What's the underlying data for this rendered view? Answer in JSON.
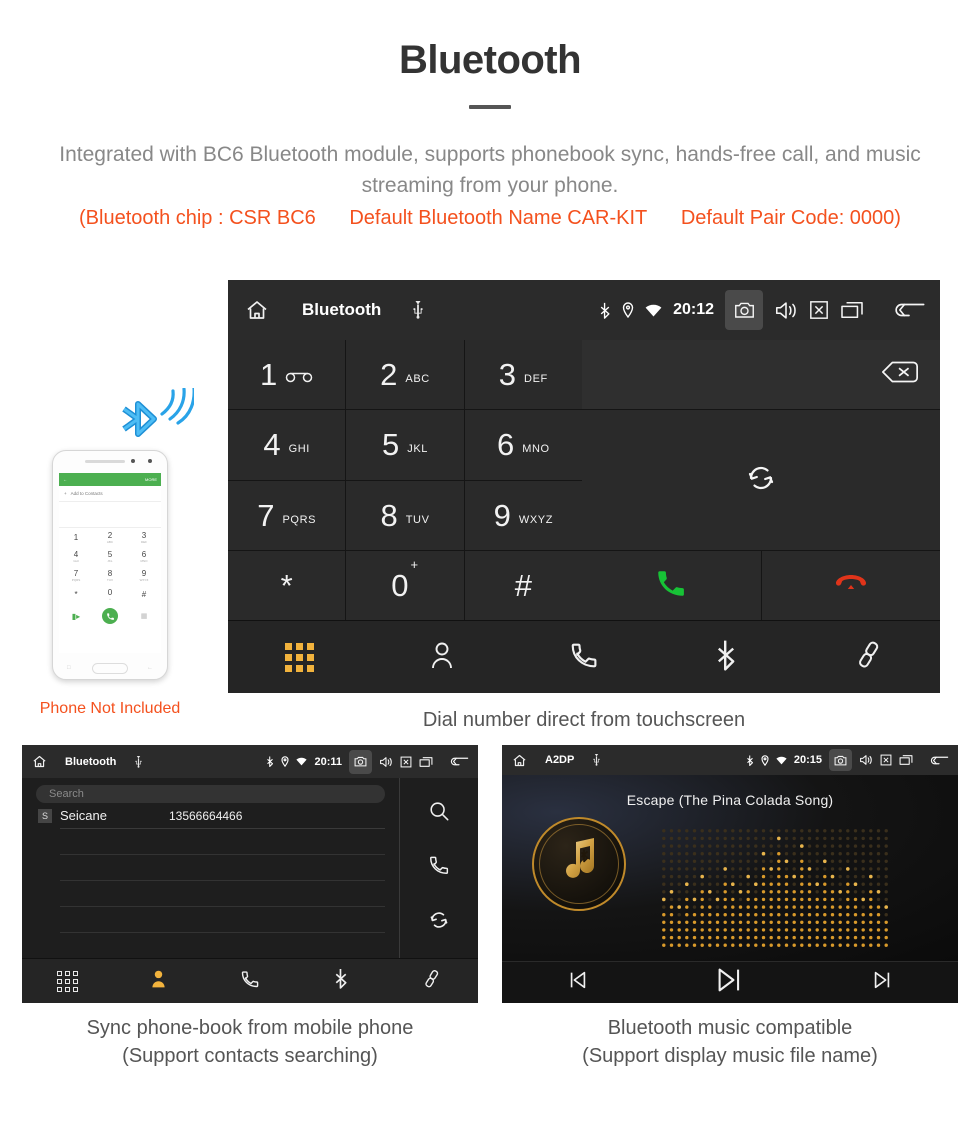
{
  "header": {
    "title": "Bluetooth",
    "subtitle": "Integrated with BC6 Bluetooth module, supports phonebook sync, hands-free call, and music streaming from your phone.",
    "spec_open": "(Bluetooth chip : CSR BC6",
    "spec_name": "Default Bluetooth Name CAR-KIT",
    "spec_pair": "Default Pair Code: 0000)",
    "accent_color": "#f4511e",
    "text_color": "#888888"
  },
  "dialer": {
    "statusbar": {
      "home_icon": "home-icon",
      "title": "Bluetooth",
      "usb_icon": "usb-icon",
      "bluetooth_icon": "bluetooth-icon",
      "location_icon": "location-icon",
      "wifi_icon": "wifi-icon",
      "time": "20:12",
      "camera_icon": "camera-icon",
      "volume_icon": "volume-icon",
      "close_icon": "close-box-icon",
      "recents_icon": "recent-apps-icon",
      "back_icon": "back-icon"
    },
    "keys": [
      {
        "digit": "1",
        "letters": "",
        "icon": "voicemail-icon"
      },
      {
        "digit": "2",
        "letters": "ABC",
        "icon": ""
      },
      {
        "digit": "3",
        "letters": "DEF",
        "icon": ""
      },
      {
        "digit": "4",
        "letters": "GHI",
        "icon": ""
      },
      {
        "digit": "5",
        "letters": "JKL",
        "icon": ""
      },
      {
        "digit": "6",
        "letters": "MNO",
        "icon": ""
      },
      {
        "digit": "7",
        "letters": "PQRS",
        "icon": ""
      },
      {
        "digit": "8",
        "letters": "TUV",
        "icon": ""
      },
      {
        "digit": "9",
        "letters": "WXYZ",
        "icon": ""
      },
      {
        "digit": "*",
        "letters": "",
        "icon": ""
      },
      {
        "digit": "0",
        "letters": "+",
        "icon": ""
      },
      {
        "digit": "#",
        "letters": "",
        "icon": ""
      }
    ],
    "number_input_value": "",
    "backspace_icon": "backspace-icon",
    "sync_icon": "sync-icon",
    "call_icon": "call-icon",
    "hangup_icon": "hangup-icon",
    "call_color": "#17c236",
    "hangup_color": "#e0341a",
    "nav": [
      {
        "icon": "dialpad-icon",
        "active": true
      },
      {
        "icon": "contacts-icon",
        "active": false
      },
      {
        "icon": "call-log-icon",
        "active": false
      },
      {
        "icon": "bluetooth-icon",
        "active": false
      },
      {
        "icon": "pair-link-icon",
        "active": false
      }
    ],
    "active_color": "#f2b33d"
  },
  "phone_mock": {
    "header_more": "MORE",
    "add_to_contacts": "Add to Contacts",
    "keys": [
      {
        "d": "1",
        "l": ""
      },
      {
        "d": "2",
        "l": "ABC"
      },
      {
        "d": "3",
        "l": "DEF"
      },
      {
        "d": "4",
        "l": "GHI"
      },
      {
        "d": "5",
        "l": "JKL"
      },
      {
        "d": "6",
        "l": "MNO"
      },
      {
        "d": "7",
        "l": "PQRS"
      },
      {
        "d": "8",
        "l": "TUV"
      },
      {
        "d": "9",
        "l": "WXYZ"
      },
      {
        "d": "*",
        "l": ""
      },
      {
        "d": "0",
        "l": "+"
      },
      {
        "d": "#",
        "l": ""
      }
    ],
    "note": "Phone Not Included",
    "note_color": "#f4511e",
    "bluetooth_logo_color": "#29a3e8"
  },
  "captions": {
    "dialer": "Dial number direct from touchscreen",
    "phonebook_line1": "Sync phone-book from mobile phone",
    "phonebook_line2": "(Support contacts searching)",
    "music_line1": "Bluetooth music compatible",
    "music_line2": "(Support display music file name)"
  },
  "phonebook": {
    "statusbar": {
      "title": "Bluetooth",
      "time": "20:11"
    },
    "search_placeholder": "Search",
    "contacts": [
      {
        "initial": "S",
        "name": "Seicane",
        "number": "13566664466"
      }
    ],
    "empty_rows": 4,
    "side_icons": [
      {
        "icon": "search-icon"
      },
      {
        "icon": "call-icon"
      },
      {
        "icon": "sync-icon"
      }
    ],
    "nav": [
      {
        "icon": "dialpad-icon",
        "active": false
      },
      {
        "icon": "contacts-icon",
        "active": true
      },
      {
        "icon": "call-log-icon",
        "active": false
      },
      {
        "icon": "bluetooth-icon",
        "active": false
      },
      {
        "icon": "pair-link-icon",
        "active": false
      }
    ]
  },
  "music": {
    "statusbar": {
      "title": "A2DP",
      "time": "20:15"
    },
    "track_title": "Escape (The Pina Colada Song)",
    "album_icon": "bluetooth-music-note-icon",
    "visualizer": {
      "columns": 30,
      "rows": 16,
      "levels": [
        5,
        6,
        4,
        7,
        5,
        8,
        6,
        5,
        9,
        7,
        6,
        8,
        7,
        11,
        9,
        13,
        10,
        8,
        12,
        9,
        7,
        10,
        8,
        6,
        9,
        7,
        5,
        8,
        6,
        4
      ]
    },
    "controls": [
      {
        "icon": "previous-track-icon"
      },
      {
        "icon": "play-pause-icon"
      },
      {
        "icon": "next-track-icon"
      }
    ],
    "accent_color": "#d6a13c"
  }
}
